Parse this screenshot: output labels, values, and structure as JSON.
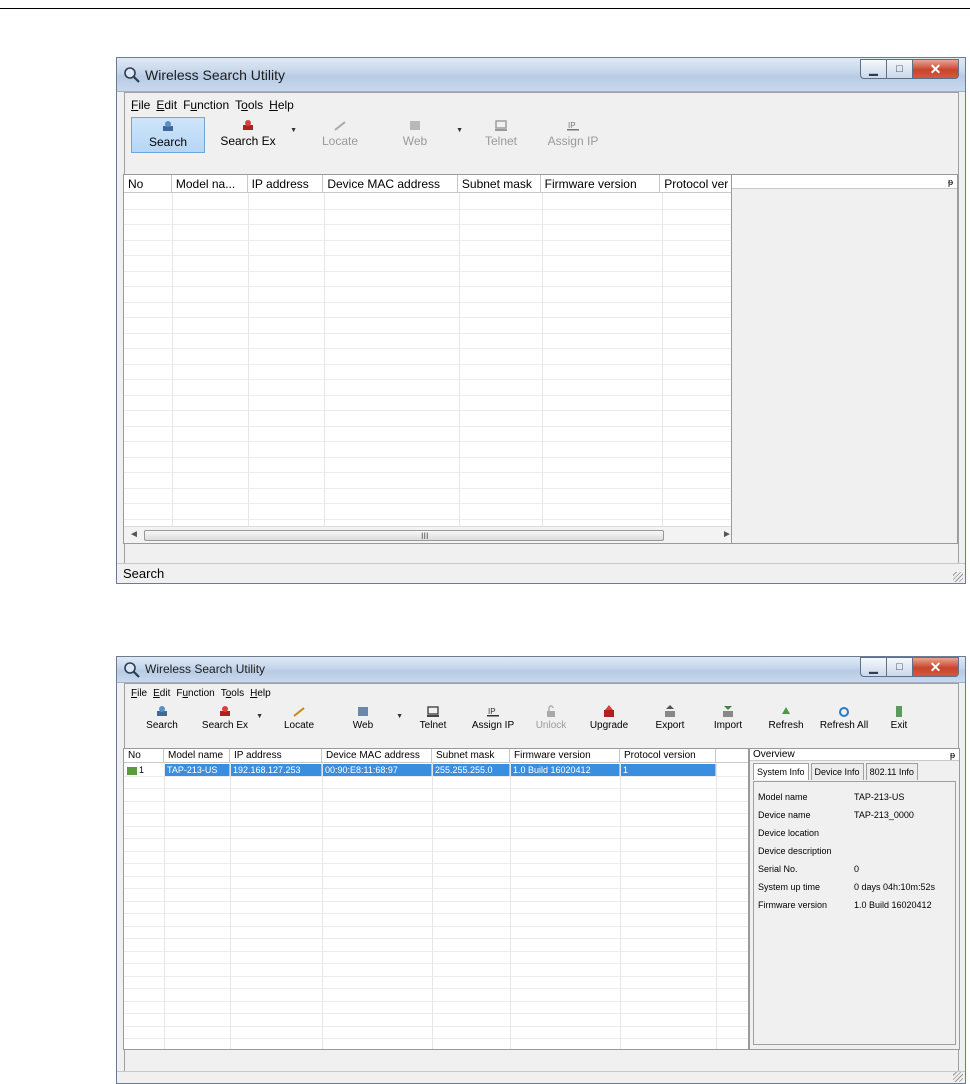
{
  "window1": {
    "title": "Wireless Search Utility",
    "menu": [
      {
        "accel": "F",
        "rest": "ile"
      },
      {
        "accel": "E",
        "rest": "dit"
      },
      {
        "pre": "F",
        "accel": "u",
        "rest": "nction"
      },
      {
        "pre": "T",
        "accel": "o",
        "rest": "ols"
      },
      {
        "accel": "H",
        "rest": "elp"
      }
    ],
    "toolbar": [
      {
        "label": "Search",
        "icon": "search-icon"
      },
      {
        "label": "Search Ex",
        "icon": "search-ex-icon"
      },
      {
        "label": "Locate",
        "icon": "locate-icon"
      },
      {
        "label": "Web",
        "icon": "web-icon"
      },
      {
        "label": "Telnet",
        "icon": "telnet-icon"
      },
      {
        "label": "Assign IP",
        "icon": "ip-icon"
      }
    ],
    "columns": [
      "No",
      "Model na...",
      "IP address",
      "Device MAC address",
      "Subnet mask",
      "Firmware version",
      "Protocol ver"
    ],
    "scroll_grip": "III",
    "scroll_left": "◄",
    "scroll_right": "►",
    "pin": "ᵽ",
    "status": "Search"
  },
  "window2": {
    "title": "Wireless Search Utility",
    "menu": [
      {
        "accel": "F",
        "rest": "ile"
      },
      {
        "accel": "E",
        "rest": "dit"
      },
      {
        "pre": "F",
        "accel": "u",
        "rest": "nction"
      },
      {
        "pre": "T",
        "accel": "o",
        "rest": "ols"
      },
      {
        "accel": "H",
        "rest": "elp"
      }
    ],
    "toolbar": [
      {
        "label": "Search",
        "icon": "search-icon"
      },
      {
        "label": "Search Ex",
        "icon": "search-ex-icon"
      },
      {
        "label": "Locate",
        "icon": "locate-icon"
      },
      {
        "label": "Web",
        "icon": "web-icon"
      },
      {
        "label": "Telnet",
        "icon": "telnet-icon"
      },
      {
        "label": "Assign IP",
        "icon": "ip-icon"
      },
      {
        "label": "Unlock",
        "icon": "unlock-icon"
      },
      {
        "label": "Upgrade",
        "icon": "upgrade-icon"
      },
      {
        "label": "Export",
        "icon": "export-icon"
      },
      {
        "label": "Import",
        "icon": "import-icon"
      },
      {
        "label": "Refresh",
        "icon": "refresh-icon"
      },
      {
        "label": "Refresh All",
        "icon": "refresh-all-icon"
      },
      {
        "label": "Exit",
        "icon": "exit-icon"
      }
    ],
    "columns": [
      "No",
      "Model name",
      "IP address",
      "Device MAC address",
      "Subnet mask",
      "Firmware version",
      "Protocol version"
    ],
    "row": {
      "no": "1",
      "model": "TAP-213-US",
      "ip": "192.168.127.253",
      "mac": "00:90:E8:11:68:97",
      "subnet": "255.255.255.0",
      "firmware": "1.0 Build 16020412",
      "protocol": "1"
    },
    "overview": {
      "title": "Overview",
      "pin": "ᵽ",
      "tabs": [
        "System Info",
        "Device Info",
        "802.11 Info"
      ],
      "info": [
        {
          "label": "Model name",
          "value": "TAP-213-US"
        },
        {
          "label": "Device name",
          "value": "TAP-213_0000"
        },
        {
          "label": "Device location",
          "value": ""
        },
        {
          "label": "Device description",
          "value": ""
        },
        {
          "label": "Serial No.",
          "value": "0"
        },
        {
          "label": "System up time",
          "value": "0 days 04h:10m:52s"
        },
        {
          "label": "Firmware version",
          "value": "1.0 Build 16020412"
        }
      ]
    }
  },
  "colors": {
    "selection": "#3a8ee0",
    "titlebar": "#c4d5ea",
    "close": "#c8452c"
  }
}
